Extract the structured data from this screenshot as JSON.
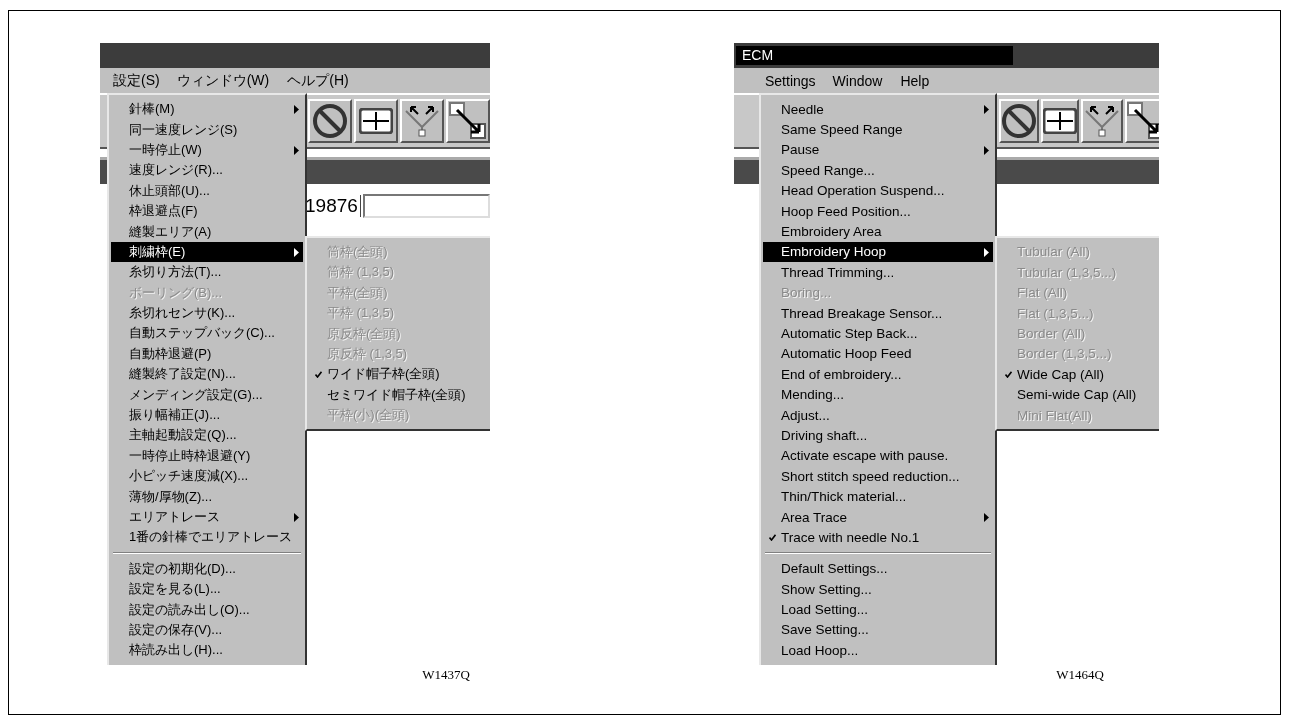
{
  "figures": [
    {
      "menubar": [
        {
          "label": "設定(S)",
          "selected": true
        },
        {
          "label": "ウィンドウ(W)",
          "selected": false
        },
        {
          "label": "ヘルプ(H)",
          "selected": false
        }
      ],
      "field_value": "19876",
      "menu": [
        {
          "kind": "item",
          "label": "針棒(M)",
          "submenu": true,
          "checked": false,
          "disabled": false,
          "selected": false
        },
        {
          "kind": "item",
          "label": "同一速度レンジ(S)",
          "submenu": false,
          "checked": false,
          "disabled": false,
          "selected": false
        },
        {
          "kind": "item",
          "label": "一時停止(W)",
          "submenu": true,
          "checked": false,
          "disabled": false,
          "selected": false
        },
        {
          "kind": "item",
          "label": "速度レンジ(R)...",
          "submenu": false,
          "checked": false,
          "disabled": false,
          "selected": false
        },
        {
          "kind": "item",
          "label": "休止頭部(U)...",
          "submenu": false,
          "checked": false,
          "disabled": false,
          "selected": false
        },
        {
          "kind": "item",
          "label": "枠退避点(F)",
          "submenu": false,
          "checked": false,
          "disabled": false,
          "selected": false
        },
        {
          "kind": "item",
          "label": "縫製エリア(A)",
          "submenu": false,
          "checked": false,
          "disabled": false,
          "selected": false
        },
        {
          "kind": "item",
          "label": "刺繍枠(E)",
          "submenu": true,
          "checked": false,
          "disabled": false,
          "selected": true
        },
        {
          "kind": "item",
          "label": "糸切り方法(T)...",
          "submenu": false,
          "checked": false,
          "disabled": false,
          "selected": false
        },
        {
          "kind": "item",
          "label": "ボーリング(B)...",
          "submenu": false,
          "checked": false,
          "disabled": true,
          "selected": false
        },
        {
          "kind": "item",
          "label": "糸切れセンサ(K)...",
          "submenu": false,
          "checked": false,
          "disabled": false,
          "selected": false
        },
        {
          "kind": "item",
          "label": "自動ステップバック(C)...",
          "submenu": false,
          "checked": false,
          "disabled": false,
          "selected": false
        },
        {
          "kind": "item",
          "label": "自動枠退避(P)",
          "submenu": false,
          "checked": false,
          "disabled": false,
          "selected": false
        },
        {
          "kind": "item",
          "label": "縫製終了設定(N)...",
          "submenu": false,
          "checked": false,
          "disabled": false,
          "selected": false
        },
        {
          "kind": "item",
          "label": "メンディング設定(G)...",
          "submenu": false,
          "checked": false,
          "disabled": false,
          "selected": false
        },
        {
          "kind": "item",
          "label": "振り幅補正(J)...",
          "submenu": false,
          "checked": false,
          "disabled": false,
          "selected": false
        },
        {
          "kind": "item",
          "label": "主軸起動設定(Q)...",
          "submenu": false,
          "checked": false,
          "disabled": false,
          "selected": false
        },
        {
          "kind": "item",
          "label": "一時停止時枠退避(Y)",
          "submenu": false,
          "checked": false,
          "disabled": false,
          "selected": false
        },
        {
          "kind": "item",
          "label": "小ピッチ速度減(X)...",
          "submenu": false,
          "checked": false,
          "disabled": false,
          "selected": false
        },
        {
          "kind": "item",
          "label": "薄物/厚物(Z)...",
          "submenu": false,
          "checked": false,
          "disabled": false,
          "selected": false
        },
        {
          "kind": "item",
          "label": "エリアトレース",
          "submenu": true,
          "checked": false,
          "disabled": false,
          "selected": false
        },
        {
          "kind": "item",
          "label": "1番の針棒でエリアトレース",
          "submenu": false,
          "checked": false,
          "disabled": false,
          "selected": false
        },
        {
          "kind": "separator"
        },
        {
          "kind": "item",
          "label": "設定の初期化(D)...",
          "submenu": false,
          "checked": false,
          "disabled": false,
          "selected": false
        },
        {
          "kind": "item",
          "label": "設定を見る(L)...",
          "submenu": false,
          "checked": false,
          "disabled": false,
          "selected": false
        },
        {
          "kind": "item",
          "label": "設定の読み出し(O)...",
          "submenu": false,
          "checked": false,
          "disabled": false,
          "selected": false
        },
        {
          "kind": "item",
          "label": "設定の保存(V)...",
          "submenu": false,
          "checked": false,
          "disabled": false,
          "selected": false
        },
        {
          "kind": "item",
          "label": "枠読み出し(H)...",
          "submenu": false,
          "checked": false,
          "disabled": false,
          "selected": false
        }
      ],
      "submenu": [
        {
          "kind": "item",
          "label": "筒枠(全頭)",
          "submenu": false,
          "checked": false,
          "disabled": true,
          "selected": false
        },
        {
          "kind": "item",
          "label": "筒枠 (1,3,5)",
          "submenu": false,
          "checked": false,
          "disabled": true,
          "selected": false
        },
        {
          "kind": "item",
          "label": "平枠(全頭)",
          "submenu": false,
          "checked": false,
          "disabled": true,
          "selected": false
        },
        {
          "kind": "item",
          "label": "平枠 (1,3,5)",
          "submenu": false,
          "checked": false,
          "disabled": true,
          "selected": false
        },
        {
          "kind": "item",
          "label": "原反枠(全頭)",
          "submenu": false,
          "checked": false,
          "disabled": true,
          "selected": false
        },
        {
          "kind": "item",
          "label": "原反枠 (1,3,5)",
          "submenu": false,
          "checked": false,
          "disabled": true,
          "selected": false
        },
        {
          "kind": "item",
          "label": "ワイド帽子枠(全頭)",
          "submenu": false,
          "checked": true,
          "disabled": false,
          "selected": false
        },
        {
          "kind": "item",
          "label": "セミワイド帽子枠(全頭)",
          "submenu": false,
          "checked": false,
          "disabled": false,
          "selected": false
        },
        {
          "kind": "item",
          "label": "平枠(小)(全頭)",
          "submenu": false,
          "checked": false,
          "disabled": true,
          "selected": false
        }
      ],
      "caption": "W1437Q"
    },
    {
      "window_title": "ECM",
      "menubar": [
        {
          "label": "Settings",
          "selected": true
        },
        {
          "label": "Window",
          "selected": false
        },
        {
          "label": "Help",
          "selected": false
        }
      ],
      "menu": [
        {
          "kind": "item",
          "label": "Needle",
          "submenu": true,
          "checked": false,
          "disabled": false,
          "selected": false
        },
        {
          "kind": "item",
          "label": "Same Speed Range",
          "submenu": false,
          "checked": false,
          "disabled": false,
          "selected": false
        },
        {
          "kind": "item",
          "label": "Pause",
          "submenu": true,
          "checked": false,
          "disabled": false,
          "selected": false
        },
        {
          "kind": "item",
          "label": "Speed Range...",
          "submenu": false,
          "checked": false,
          "disabled": false,
          "selected": false
        },
        {
          "kind": "item",
          "label": "Head Operation Suspend...",
          "submenu": false,
          "checked": false,
          "disabled": false,
          "selected": false
        },
        {
          "kind": "item",
          "label": "Hoop Feed Position...",
          "submenu": false,
          "checked": false,
          "disabled": false,
          "selected": false
        },
        {
          "kind": "item",
          "label": "Embroidery Area",
          "submenu": false,
          "checked": false,
          "disabled": false,
          "selected": false
        },
        {
          "kind": "item",
          "label": "Embroidery Hoop",
          "submenu": true,
          "checked": false,
          "disabled": false,
          "selected": true
        },
        {
          "kind": "item",
          "label": "Thread Trimming...",
          "submenu": false,
          "checked": false,
          "disabled": false,
          "selected": false
        },
        {
          "kind": "item",
          "label": "Boring...",
          "submenu": false,
          "checked": false,
          "disabled": true,
          "selected": false
        },
        {
          "kind": "item",
          "label": "Thread Breakage Sensor...",
          "submenu": false,
          "checked": false,
          "disabled": false,
          "selected": false
        },
        {
          "kind": "item",
          "label": "Automatic Step Back...",
          "submenu": false,
          "checked": false,
          "disabled": false,
          "selected": false
        },
        {
          "kind": "item",
          "label": "Automatic Hoop Feed",
          "submenu": false,
          "checked": false,
          "disabled": false,
          "selected": false
        },
        {
          "kind": "item",
          "label": "End of embroidery...",
          "submenu": false,
          "checked": false,
          "disabled": false,
          "selected": false
        },
        {
          "kind": "item",
          "label": "Mending...",
          "submenu": false,
          "checked": false,
          "disabled": false,
          "selected": false
        },
        {
          "kind": "item",
          "label": "Adjust...",
          "submenu": false,
          "checked": false,
          "disabled": false,
          "selected": false
        },
        {
          "kind": "item",
          "label": "Driving shaft...",
          "submenu": false,
          "checked": false,
          "disabled": false,
          "selected": false
        },
        {
          "kind": "item",
          "label": "Activate escape with pause.",
          "submenu": false,
          "checked": false,
          "disabled": false,
          "selected": false
        },
        {
          "kind": "item",
          "label": "Short stitch speed reduction...",
          "submenu": false,
          "checked": false,
          "disabled": false,
          "selected": false
        },
        {
          "kind": "item",
          "label": "Thin/Thick material...",
          "submenu": false,
          "checked": false,
          "disabled": false,
          "selected": false
        },
        {
          "kind": "item",
          "label": "Area Trace",
          "submenu": true,
          "checked": false,
          "disabled": false,
          "selected": false
        },
        {
          "kind": "item",
          "label": "Trace with needle No.1",
          "submenu": false,
          "checked": true,
          "disabled": false,
          "selected": false
        },
        {
          "kind": "separator"
        },
        {
          "kind": "item",
          "label": "Default Settings...",
          "submenu": false,
          "checked": false,
          "disabled": false,
          "selected": false
        },
        {
          "kind": "item",
          "label": "Show Setting...",
          "submenu": false,
          "checked": false,
          "disabled": false,
          "selected": false
        },
        {
          "kind": "item",
          "label": "Load Setting...",
          "submenu": false,
          "checked": false,
          "disabled": false,
          "selected": false
        },
        {
          "kind": "item",
          "label": "Save Setting...",
          "submenu": false,
          "checked": false,
          "disabled": false,
          "selected": false
        },
        {
          "kind": "item",
          "label": "Load Hoop...",
          "submenu": false,
          "checked": false,
          "disabled": false,
          "selected": false
        }
      ],
      "submenu": [
        {
          "kind": "item",
          "label": "Tubular (All)",
          "submenu": false,
          "checked": false,
          "disabled": true,
          "selected": false
        },
        {
          "kind": "item",
          "label": "Tubular (1,3,5...)",
          "submenu": false,
          "checked": false,
          "disabled": true,
          "selected": false
        },
        {
          "kind": "item",
          "label": "Flat (All)",
          "submenu": false,
          "checked": false,
          "disabled": true,
          "selected": false
        },
        {
          "kind": "item",
          "label": "Flat (1,3,5...)",
          "submenu": false,
          "checked": false,
          "disabled": true,
          "selected": false
        },
        {
          "kind": "item",
          "label": "Border (All)",
          "submenu": false,
          "checked": false,
          "disabled": true,
          "selected": false
        },
        {
          "kind": "item",
          "label": "Border (1,3,5...)",
          "submenu": false,
          "checked": false,
          "disabled": true,
          "selected": false
        },
        {
          "kind": "item",
          "label": "Wide Cap (All)",
          "submenu": false,
          "checked": true,
          "disabled": false,
          "selected": false
        },
        {
          "kind": "item",
          "label": "Semi-wide Cap (All)",
          "submenu": false,
          "checked": false,
          "disabled": false,
          "selected": false
        },
        {
          "kind": "item",
          "label": "Mini Flat(All)",
          "submenu": false,
          "checked": false,
          "disabled": true,
          "selected": false
        }
      ],
      "caption": "W1464Q"
    }
  ]
}
